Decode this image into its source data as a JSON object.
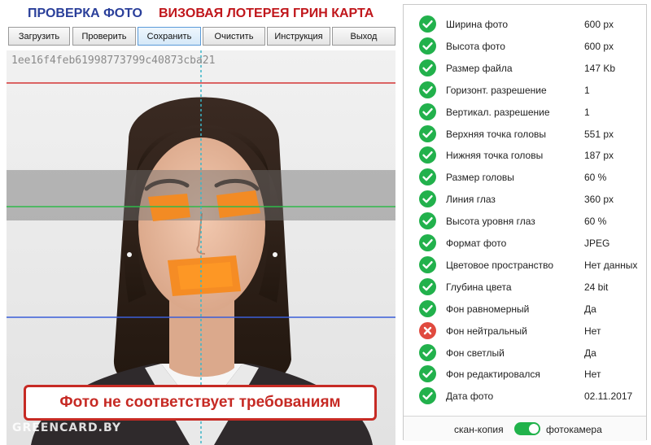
{
  "header": {
    "title_left": "ПРОВЕРКА ФОТО",
    "title_right": "ВИЗОВАЯ ЛОТЕРЕЯ ГРИН КАРТА"
  },
  "toolbar": {
    "load": "Загрузить",
    "check": "Проверить",
    "save": "Сохранить",
    "clear": "Очистить",
    "instructions": "Инструкция",
    "exit": "Выход"
  },
  "photo": {
    "hash": "1ee16f4feb61998773799c40873cba21",
    "warning": "Фото не соответствует требованиям",
    "watermark": "GREENCARD.BY"
  },
  "checks": [
    {
      "label": "Ширина фото",
      "value": "600 px",
      "status": "ok"
    },
    {
      "label": "Высота фото",
      "value": "600 px",
      "status": "ok"
    },
    {
      "label": "Размер файла",
      "value": "147 Kb",
      "status": "ok"
    },
    {
      "label": "Горизонт. разрешение",
      "value": "1",
      "status": "ok"
    },
    {
      "label": "Вертикал. разрешение",
      "value": "1",
      "status": "ok"
    },
    {
      "label": "Верхняя точка головы",
      "value": "551 px",
      "status": "ok"
    },
    {
      "label": "Нижняя точка головы",
      "value": "187 px",
      "status": "ok"
    },
    {
      "label": "Размер головы",
      "value": "60 %",
      "status": "ok"
    },
    {
      "label": "Линия глаз",
      "value": "360 px",
      "status": "ok"
    },
    {
      "label": "Высота уровня глаз",
      "value": "60 %",
      "status": "ok"
    },
    {
      "label": "Формат фото",
      "value": "JPEG",
      "status": "ok"
    },
    {
      "label": "Цветовое пространство",
      "value": "Нет данных",
      "status": "ok"
    },
    {
      "label": "Глубина цвета",
      "value": "24 bit",
      "status": "ok"
    },
    {
      "label": "Фон равномерный",
      "value": "Да",
      "status": "ok"
    },
    {
      "label": "Фон нейтральный",
      "value": "Нет",
      "status": "fail"
    },
    {
      "label": "Фон светлый",
      "value": "Да",
      "status": "ok"
    },
    {
      "label": "Фон редактировался",
      "value": "Нет",
      "status": "ok"
    },
    {
      "label": "Дата фото",
      "value": "02.11.2017",
      "status": "ok"
    }
  ],
  "footer": {
    "left_label": "скан-копия",
    "right_label": "фотокамера",
    "toggle_on": true
  },
  "colors": {
    "ok": "#22b14c",
    "fail": "#e04a3f",
    "title_blue": "#2a3f9a",
    "title_red": "#c0161b",
    "warning_red": "#c62a24",
    "toggle": "#21b24b"
  }
}
